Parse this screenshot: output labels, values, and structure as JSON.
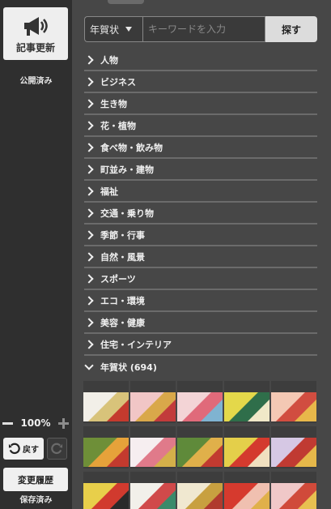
{
  "sidebar": {
    "update_label": "記事更新",
    "publish_status": "公開済み",
    "zoom": "100%",
    "undo_label": "戻す",
    "history_label": "変更履歴",
    "save_status": "保存済み",
    "icons": [
      "megaphone-icon",
      "undo-icon",
      "redo-icon",
      "minus-icon",
      "plus-icon"
    ]
  },
  "search": {
    "select_value": "年賀状",
    "placeholder": "キーワードを入力",
    "button_label": "探す"
  },
  "categories": [
    {
      "label": "人物"
    },
    {
      "label": "ビジネス"
    },
    {
      "label": "生き物"
    },
    {
      "label": "花・植物"
    },
    {
      "label": "食べ物・飲み物"
    },
    {
      "label": "町並み・建物"
    },
    {
      "label": "福祉"
    },
    {
      "label": "交通・乗り物"
    },
    {
      "label": "季節・行事"
    },
    {
      "label": "自然・風景"
    },
    {
      "label": "スポーツ"
    },
    {
      "label": "エコ・環境"
    },
    {
      "label": "美容・健康"
    },
    {
      "label": "住宅・インテリア"
    },
    {
      "label": "年賀状 (694)"
    }
  ],
  "thumbnails": {
    "rows": [
      [
        {
          "name": "fans-on-white",
          "colors": [
            "#f2efe8",
            "#d8c37a",
            "#c43a2e"
          ]
        },
        {
          "name": "fans-on-pink",
          "colors": [
            "#f1c6c6",
            "#d9a84a",
            "#c23b3b"
          ]
        },
        {
          "name": "flowers-on-pink",
          "colors": [
            "#f3d4d6",
            "#e06a7a",
            "#7fb3d1"
          ]
        },
        {
          "name": "green-yellow-split",
          "colors": [
            "#e4d84a",
            "#2f6e4a",
            "#f0e8c8"
          ]
        },
        {
          "name": "fans-on-peach",
          "colors": [
            "#f4c8b4",
            "#d14d40",
            "#e8b84a"
          ]
        }
      ],
      [
        {
          "name": "2016-on-green",
          "colors": [
            "#6e8f38",
            "#e6a23a",
            "#c33a2e"
          ]
        },
        {
          "name": "flowers-on-white",
          "colors": [
            "#f6eef0",
            "#e07a8a",
            "#d4b04a"
          ]
        },
        {
          "name": "gold-on-green",
          "colors": [
            "#5f8a3a",
            "#e0b04a",
            "#c23a30"
          ]
        },
        {
          "name": "red-yellow-split",
          "colors": [
            "#e4cf4a",
            "#d43a2e",
            "#f0e0c0"
          ]
        },
        {
          "name": "decor-on-lilac",
          "colors": [
            "#d6c8e4",
            "#c03a32",
            "#e6b84a"
          ]
        }
      ],
      [
        {
          "name": "yellow-red-fan",
          "colors": [
            "#e8cf4a",
            "#d13a2e",
            "#2a2a2a"
          ]
        },
        {
          "name": "beads-on-white",
          "colors": [
            "#f2f0ea",
            "#d04a4a",
            "#3a8a6a"
          ]
        },
        {
          "name": "gold-rope",
          "colors": [
            "#f0e8d0",
            "#c8a040",
            "#b03a2e"
          ]
        },
        {
          "name": "red-fans",
          "colors": [
            "#d63a2e",
            "#f0c0b0",
            "#e0b04a"
          ]
        },
        {
          "name": "pink-fans",
          "colors": [
            "#f0c8c8",
            "#d04a3a",
            "#e8c050"
          ]
        }
      ]
    ]
  }
}
